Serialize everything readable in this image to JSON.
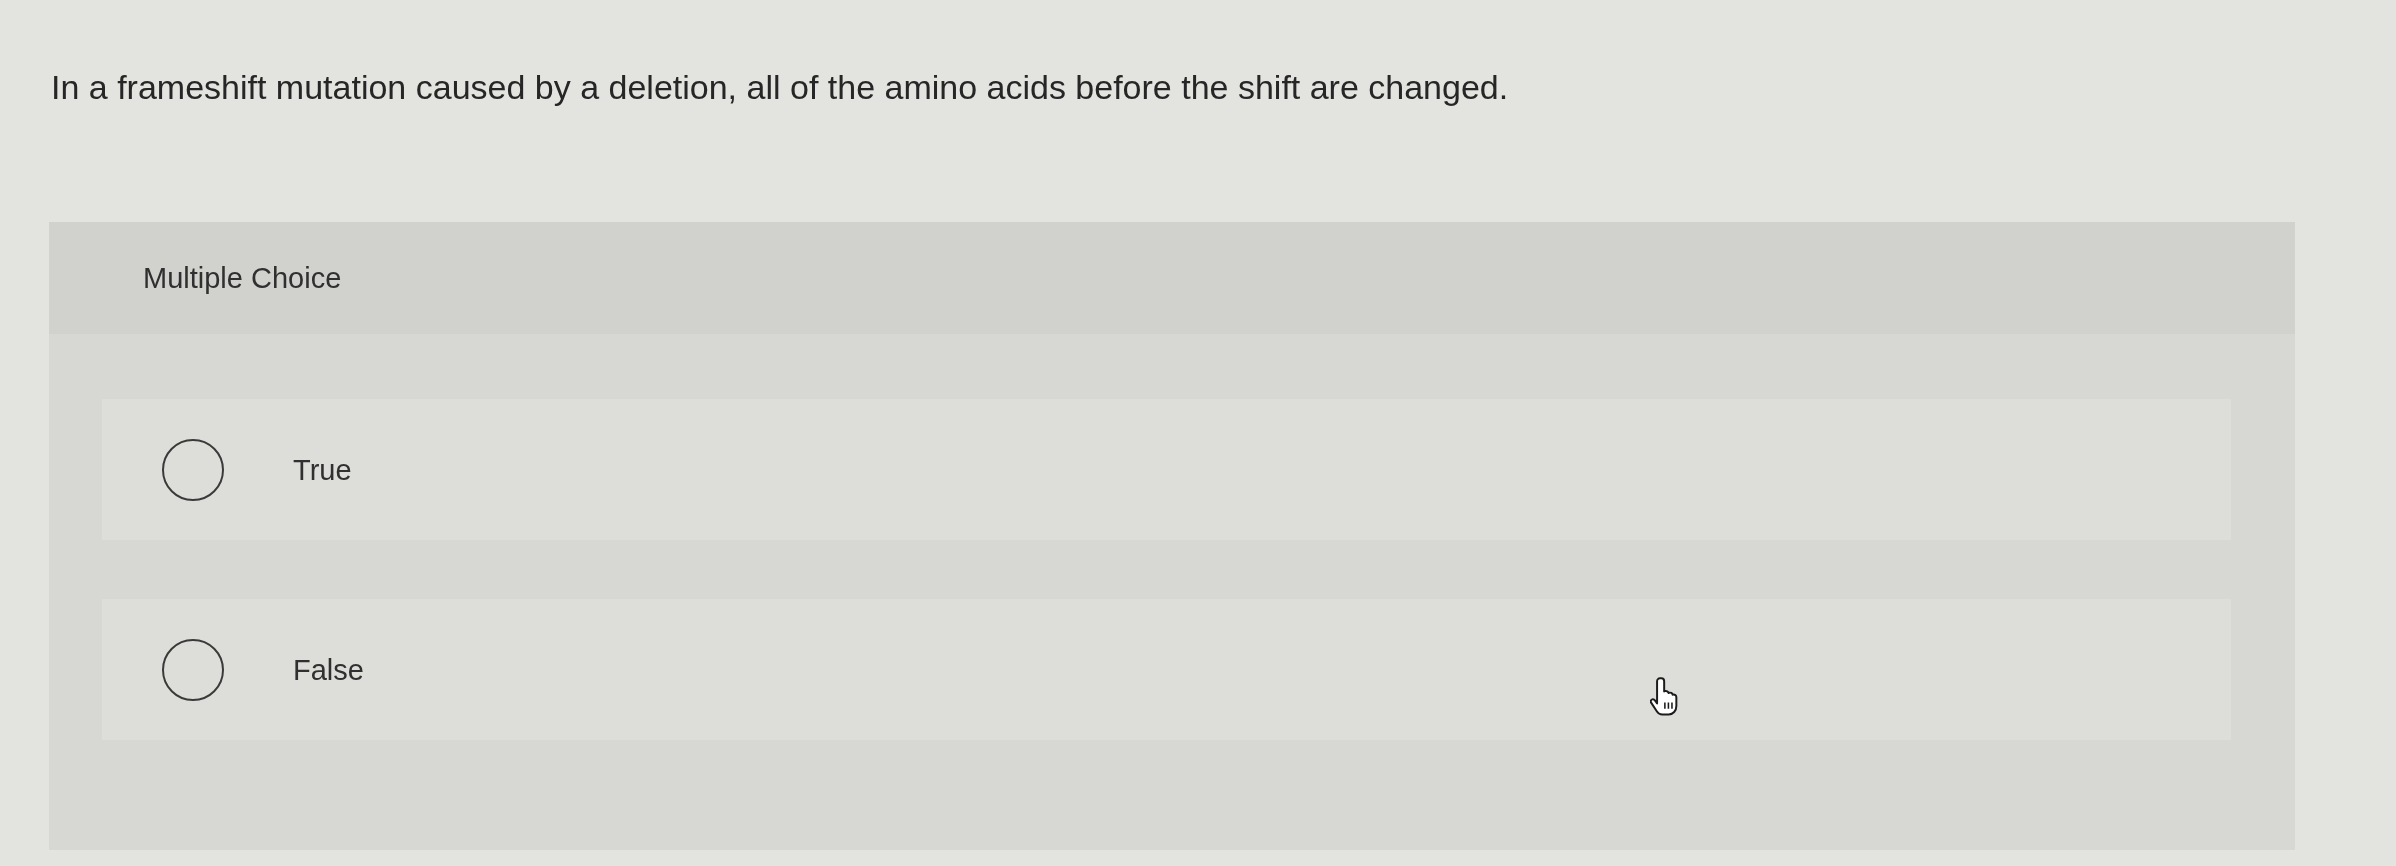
{
  "question": {
    "text": "In a frameshift mutation caused by a deletion, all of the amino acids before the shift are changed."
  },
  "answer_panel": {
    "type_label": "Multiple Choice",
    "options": [
      {
        "label": "True",
        "selected": false
      },
      {
        "label": "False",
        "selected": false
      }
    ]
  }
}
